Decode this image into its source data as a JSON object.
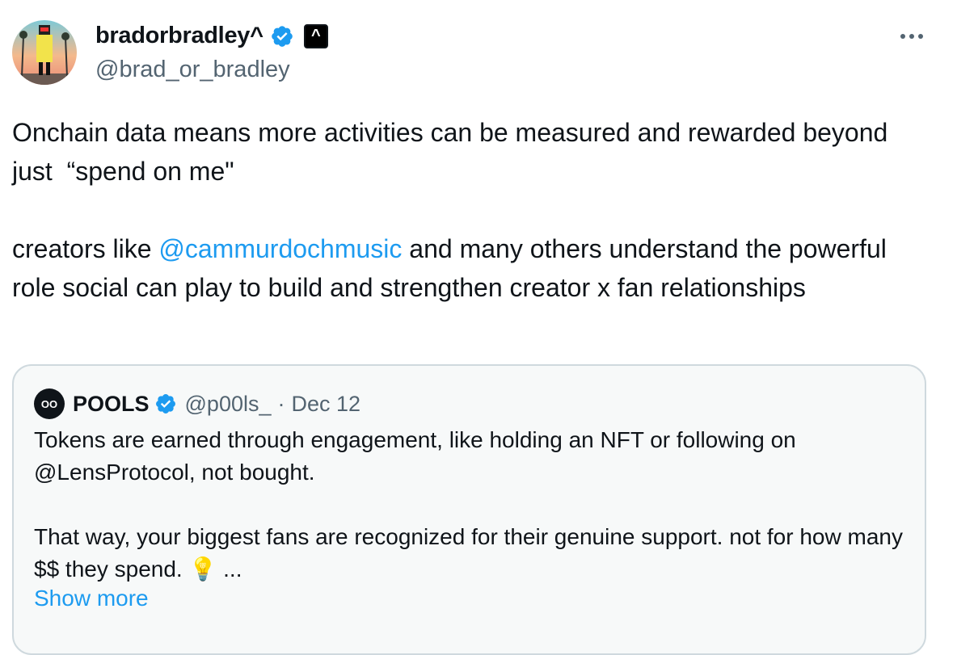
{
  "author": {
    "display_name": "bradorbradley^",
    "handle": "@brad_or_bradley",
    "affiliate_badge_glyph": "^",
    "avatar_icon": "profile-avatar",
    "verified": true
  },
  "menu": {
    "more_glyph": "···"
  },
  "tweet": {
    "line1": "Onchain data means more activities can be measured and rewarded beyond just  “spend on me\"",
    "line2_before": "creators like ",
    "mention": "@cammurdochmusic",
    "line2_after": " and many others understand the powerful role social can play to build and strengthen creator x fan relationships"
  },
  "quote": {
    "avatar_text": "OO",
    "name": "POOLS",
    "handle": "@p00ls_",
    "separator": "·",
    "date": "Dec 12",
    "text_para1": "Tokens are earned through engagement, like holding an NFT or following on @LensProtocol, not bought.",
    "text_para2": "That way, your biggest fans are recognized for their genuine support. not for how many $$ they spend.",
    "emoji": "💡",
    "ellipsis": "...",
    "show_more": "Show more"
  },
  "colors": {
    "accent": "#1d9bf0",
    "text_primary": "#0f1419",
    "text_secondary": "#536471",
    "card_border": "#cfd9de",
    "card_bg": "#f7f9f9"
  }
}
